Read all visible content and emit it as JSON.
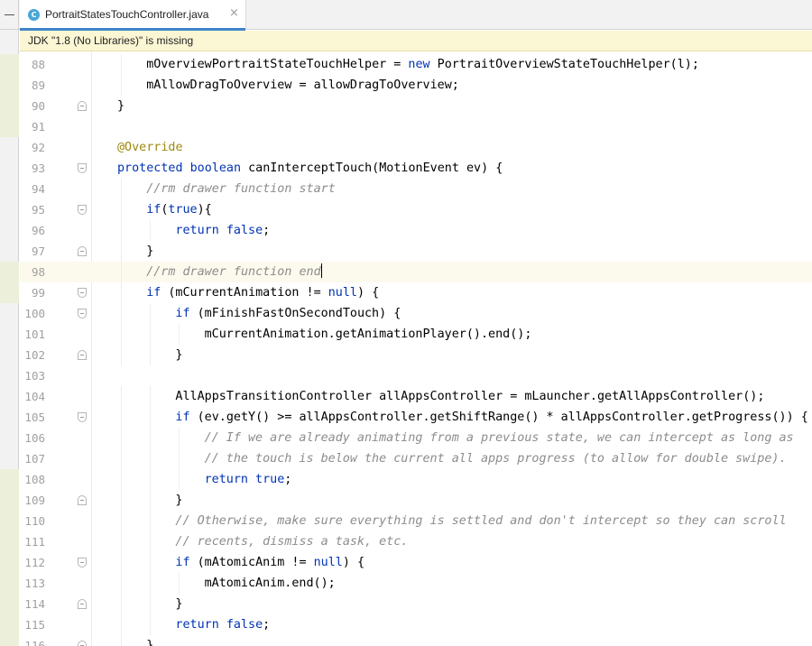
{
  "editor": {
    "tab": {
      "filename": "PortraitStatesTouchController.java",
      "icon": "java-class-icon",
      "icon_letter": "C",
      "close_glyph": "×"
    },
    "notification": "JDK \"1.8 (No Libraries)\" is missing",
    "colors": {
      "keyword": "#0033b3",
      "annotation": "#9e880d",
      "comment": "#8c8c8c",
      "line_number": "#a0a0a0",
      "tab_accent": "#4083c9",
      "banner": "#fbf6d3"
    },
    "caret_line": 98,
    "lines": [
      {
        "num": "88",
        "indent": 1,
        "segs": [
          [
            "t",
            "mOverviewPortraitStateTouchHelper = "
          ],
          [
            "kw",
            "new"
          ],
          [
            "t",
            " PortraitOverviewStateTouchHelper(l);"
          ]
        ]
      },
      {
        "num": "89",
        "indent": 1,
        "segs": [
          [
            "t",
            "mAllowDragToOverview = allowDragToOverview;"
          ]
        ]
      },
      {
        "num": "90",
        "indent": 0,
        "fold": "close",
        "segs": [
          [
            "t",
            "}"
          ]
        ]
      },
      {
        "num": "91",
        "indent": 0,
        "segs": []
      },
      {
        "num": "92",
        "indent": 0,
        "segs": [
          [
            "an",
            "@Override"
          ]
        ]
      },
      {
        "num": "93",
        "indent": 0,
        "fold": "open",
        "segs": [
          [
            "kw",
            "protected"
          ],
          [
            "t",
            " "
          ],
          [
            "kw",
            "boolean"
          ],
          [
            "t",
            " canInterceptTouch(MotionEvent ev) {"
          ]
        ]
      },
      {
        "num": "94",
        "indent": 1,
        "segs": [
          [
            "cm",
            "//rm drawer function start"
          ]
        ]
      },
      {
        "num": "95",
        "indent": 1,
        "fold": "open",
        "segs": [
          [
            "kw",
            "if"
          ],
          [
            "t",
            "("
          ],
          [
            "kw",
            "true"
          ],
          [
            "t",
            "){"
          ]
        ]
      },
      {
        "num": "96",
        "indent": 2,
        "segs": [
          [
            "kw",
            "return"
          ],
          [
            "t",
            " "
          ],
          [
            "kw",
            "false"
          ],
          [
            "t",
            ";"
          ]
        ]
      },
      {
        "num": "97",
        "indent": 1,
        "fold": "close",
        "segs": [
          [
            "t",
            "}"
          ]
        ]
      },
      {
        "num": "98",
        "indent": 1,
        "segs": [
          [
            "cm",
            "//rm drawer function end"
          ]
        ]
      },
      {
        "num": "99",
        "indent": 1,
        "fold": "open",
        "segs": [
          [
            "kw",
            "if"
          ],
          [
            "t",
            " (mCurrentAnimation != "
          ],
          [
            "kw",
            "null"
          ],
          [
            "t",
            ") {"
          ]
        ]
      },
      {
        "num": "100",
        "indent": 2,
        "fold": "open",
        "segs": [
          [
            "kw",
            "if"
          ],
          [
            "t",
            " (mFinishFastOnSecondTouch) {"
          ]
        ]
      },
      {
        "num": "101",
        "indent": 3,
        "segs": [
          [
            "t",
            "mCurrentAnimation.getAnimationPlayer().end();"
          ]
        ]
      },
      {
        "num": "102",
        "indent": 2,
        "fold": "close",
        "segs": [
          [
            "t",
            "}"
          ]
        ]
      },
      {
        "num": "103",
        "indent": 0,
        "segs": []
      },
      {
        "num": "104",
        "indent": 2,
        "segs": [
          [
            "t",
            "AllAppsTransitionController allAppsController = mLauncher.getAllAppsController();"
          ]
        ]
      },
      {
        "num": "105",
        "indent": 2,
        "fold": "open",
        "segs": [
          [
            "kw",
            "if"
          ],
          [
            "t",
            " (ev.getY() >= allAppsController.getShiftRange() * allAppsController.getProgress()) {"
          ]
        ]
      },
      {
        "num": "106",
        "indent": 3,
        "segs": [
          [
            "cm",
            "// If we are already animating from a previous state, we can intercept as long as"
          ]
        ]
      },
      {
        "num": "107",
        "indent": 3,
        "segs": [
          [
            "cm",
            "// the touch is below the current all apps progress (to allow for double swipe)."
          ]
        ]
      },
      {
        "num": "108",
        "indent": 3,
        "segs": [
          [
            "kw",
            "return"
          ],
          [
            "t",
            " "
          ],
          [
            "kw",
            "true"
          ],
          [
            "t",
            ";"
          ]
        ]
      },
      {
        "num": "109",
        "indent": 2,
        "fold": "close",
        "segs": [
          [
            "t",
            "}"
          ]
        ]
      },
      {
        "num": "110",
        "indent": 2,
        "segs": [
          [
            "cm",
            "// Otherwise, make sure everything is settled and don't intercept so they can scroll"
          ]
        ]
      },
      {
        "num": "111",
        "indent": 2,
        "segs": [
          [
            "cm",
            "// recents, dismiss a task, etc."
          ]
        ]
      },
      {
        "num": "112",
        "indent": 2,
        "fold": "open",
        "segs": [
          [
            "kw",
            "if"
          ],
          [
            "t",
            " (mAtomicAnim != "
          ],
          [
            "kw",
            "null"
          ],
          [
            "t",
            ") {"
          ]
        ]
      },
      {
        "num": "113",
        "indent": 3,
        "segs": [
          [
            "t",
            "mAtomicAnim.end();"
          ]
        ]
      },
      {
        "num": "114",
        "indent": 2,
        "fold": "close",
        "segs": [
          [
            "t",
            "}"
          ]
        ]
      },
      {
        "num": "115",
        "indent": 2,
        "segs": [
          [
            "kw",
            "return"
          ],
          [
            "t",
            " "
          ],
          [
            "kw",
            "false"
          ],
          [
            "t",
            ";"
          ]
        ]
      },
      {
        "num": "116",
        "indent": 1,
        "fold": "close",
        "segs": [
          [
            "t",
            "}"
          ]
        ]
      }
    ]
  }
}
